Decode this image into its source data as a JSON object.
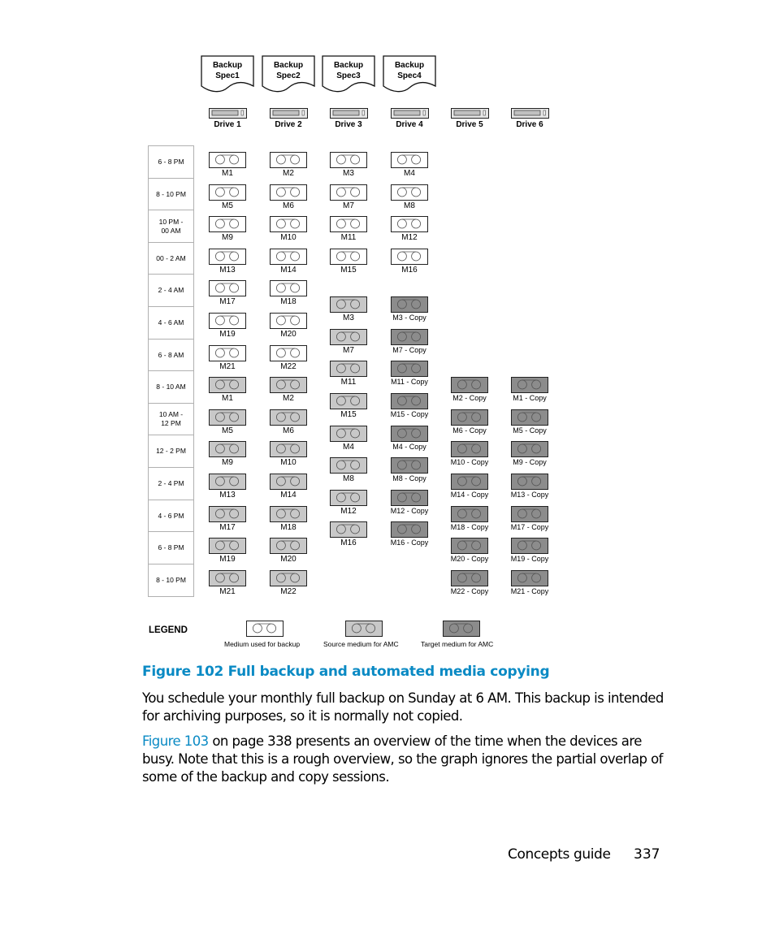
{
  "figure": {
    "backup_specs": [
      "Backup\nSpec1",
      "Backup\nSpec2",
      "Backup\nSpec3",
      "Backup\nSpec4"
    ],
    "drives": [
      "Drive 1",
      "Drive 2",
      "Drive 3",
      "Drive 4",
      "Drive 5",
      "Drive 6"
    ],
    "time_slots": [
      "6 - 8 PM",
      "8 - 10 PM",
      "10 PM -\n00 AM",
      "00 - 2 AM",
      "2 - 4 AM",
      "4 - 6 AM",
      "6 - 8 AM",
      "8 - 10 AM",
      "10 AM -\n12 PM",
      "12 - 2 PM",
      "2 - 4 PM",
      "4 - 6 PM",
      "6 - 8 PM",
      "8 - 10 PM"
    ],
    "columns": [
      {
        "drive": "Drive 1",
        "media": [
          {
            "label": "M1",
            "type": "backup",
            "slot": 0
          },
          {
            "label": "M5",
            "type": "backup",
            "slot": 1
          },
          {
            "label": "M9",
            "type": "backup",
            "slot": 2
          },
          {
            "label": "M13",
            "type": "backup",
            "slot": 3
          },
          {
            "label": "M17",
            "type": "backup",
            "slot": 4
          },
          {
            "label": "M19",
            "type": "backup",
            "slot": 5
          },
          {
            "label": "M21",
            "type": "backup",
            "slot": 6
          },
          {
            "label": "M1",
            "type": "source",
            "slot": 7
          },
          {
            "label": "M5",
            "type": "source",
            "slot": 8
          },
          {
            "label": "M9",
            "type": "source",
            "slot": 9
          },
          {
            "label": "M13",
            "type": "source",
            "slot": 10
          },
          {
            "label": "M17",
            "type": "source",
            "slot": 11
          },
          {
            "label": "M19",
            "type": "source",
            "slot": 12
          },
          {
            "label": "M21",
            "type": "source",
            "slot": 13
          }
        ]
      },
      {
        "drive": "Drive 2",
        "media": [
          {
            "label": "M2",
            "type": "backup",
            "slot": 0
          },
          {
            "label": "M6",
            "type": "backup",
            "slot": 1
          },
          {
            "label": "M10",
            "type": "backup",
            "slot": 2
          },
          {
            "label": "M14",
            "type": "backup",
            "slot": 3
          },
          {
            "label": "M18",
            "type": "backup",
            "slot": 4
          },
          {
            "label": "M20",
            "type": "backup",
            "slot": 5
          },
          {
            "label": "M22",
            "type": "backup",
            "slot": 6
          },
          {
            "label": "M2",
            "type": "source",
            "slot": 7
          },
          {
            "label": "M6",
            "type": "source",
            "slot": 8
          },
          {
            "label": "M10",
            "type": "source",
            "slot": 9
          },
          {
            "label": "M14",
            "type": "source",
            "slot": 10
          },
          {
            "label": "M18",
            "type": "source",
            "slot": 11
          },
          {
            "label": "M20",
            "type": "source",
            "slot": 12
          },
          {
            "label": "M22",
            "type": "source",
            "slot": 13
          }
        ]
      },
      {
        "drive": "Drive 3",
        "media": [
          {
            "label": "M3",
            "type": "backup",
            "slot": 0
          },
          {
            "label": "M7",
            "type": "backup",
            "slot": 1
          },
          {
            "label": "M11",
            "type": "backup",
            "slot": 2
          },
          {
            "label": "M15",
            "type": "backup",
            "slot": 3
          },
          {
            "label": "M3",
            "type": "source",
            "slot": 4.5
          },
          {
            "label": "M7",
            "type": "source",
            "slot": 5.5
          },
          {
            "label": "M11",
            "type": "source",
            "slot": 6.5
          },
          {
            "label": "M15",
            "type": "source",
            "slot": 7.5
          },
          {
            "label": "M4",
            "type": "source",
            "slot": 8.5
          },
          {
            "label": "M8",
            "type": "source",
            "slot": 9.5
          },
          {
            "label": "M12",
            "type": "source",
            "slot": 10.5
          },
          {
            "label": "M16",
            "type": "source",
            "slot": 11.5
          }
        ]
      },
      {
        "drive": "Drive 4",
        "media": [
          {
            "label": "M4",
            "type": "backup",
            "slot": 0
          },
          {
            "label": "M8",
            "type": "backup",
            "slot": 1
          },
          {
            "label": "M12",
            "type": "backup",
            "slot": 2
          },
          {
            "label": "M16",
            "type": "backup",
            "slot": 3
          },
          {
            "label": "M3 - Copy",
            "type": "target",
            "slot": 4.5
          },
          {
            "label": "M7 - Copy",
            "type": "target",
            "slot": 5.5
          },
          {
            "label": "M11 - Copy",
            "type": "target",
            "slot": 6.5
          },
          {
            "label": "M15 - Copy",
            "type": "target",
            "slot": 7.5
          },
          {
            "label": "M4 - Copy",
            "type": "target",
            "slot": 8.5
          },
          {
            "label": "M8 - Copy",
            "type": "target",
            "slot": 9.5
          },
          {
            "label": "M12 - Copy",
            "type": "target",
            "slot": 10.5
          },
          {
            "label": "M16 - Copy",
            "type": "target",
            "slot": 11.5
          }
        ]
      },
      {
        "drive": "Drive 5",
        "media": [
          {
            "label": "M2 - Copy",
            "type": "target",
            "slot": 7
          },
          {
            "label": "M6 - Copy",
            "type": "target",
            "slot": 8
          },
          {
            "label": "M10 - Copy",
            "type": "target",
            "slot": 9
          },
          {
            "label": "M14 - Copy",
            "type": "target",
            "slot": 10
          },
          {
            "label": "M18 - Copy",
            "type": "target",
            "slot": 11
          },
          {
            "label": "M20 - Copy",
            "type": "target",
            "slot": 12
          },
          {
            "label": "M22 - Copy",
            "type": "target",
            "slot": 13
          }
        ]
      },
      {
        "drive": "Drive 6",
        "media": [
          {
            "label": "M1 - Copy",
            "type": "target",
            "slot": 7
          },
          {
            "label": "M5 - Copy",
            "type": "target",
            "slot": 8
          },
          {
            "label": "M9 - Copy",
            "type": "target",
            "slot": 9
          },
          {
            "label": "M13 - Copy",
            "type": "target",
            "slot": 10
          },
          {
            "label": "M17 - Copy",
            "type": "target",
            "slot": 11
          },
          {
            "label": "M19 - Copy",
            "type": "target",
            "slot": 12
          },
          {
            "label": "M21 - Copy",
            "type": "target",
            "slot": 13
          }
        ]
      }
    ],
    "legend": {
      "title": "LEGEND",
      "items": [
        {
          "type": "backup",
          "label": "Medium used for backup"
        },
        {
          "type": "source",
          "label": "Source medium for AMC"
        },
        {
          "type": "target",
          "label": "Target medium for AMC"
        }
      ]
    },
    "colors": {
      "backup": "#ffffff",
      "source": "#c8c8c8",
      "target": "#8c8c8c",
      "caption": "#0a8ac4"
    }
  },
  "caption": "Figure 102 Full backup and automated media copying",
  "paragraphs": {
    "p1": "You schedule your monthly full backup on Sunday at 6 AM. This backup is intended for archiving purposes, so it is normally not copied.",
    "p2_link": "Figure 103",
    "p2_rest": " on page 338 presents an overview of the time when the devices are busy. Note that this is a rough overview, so the graph ignores the partial overlap of some of the backup and copy sessions."
  },
  "footer": {
    "title": "Concepts guide",
    "page": "337"
  }
}
